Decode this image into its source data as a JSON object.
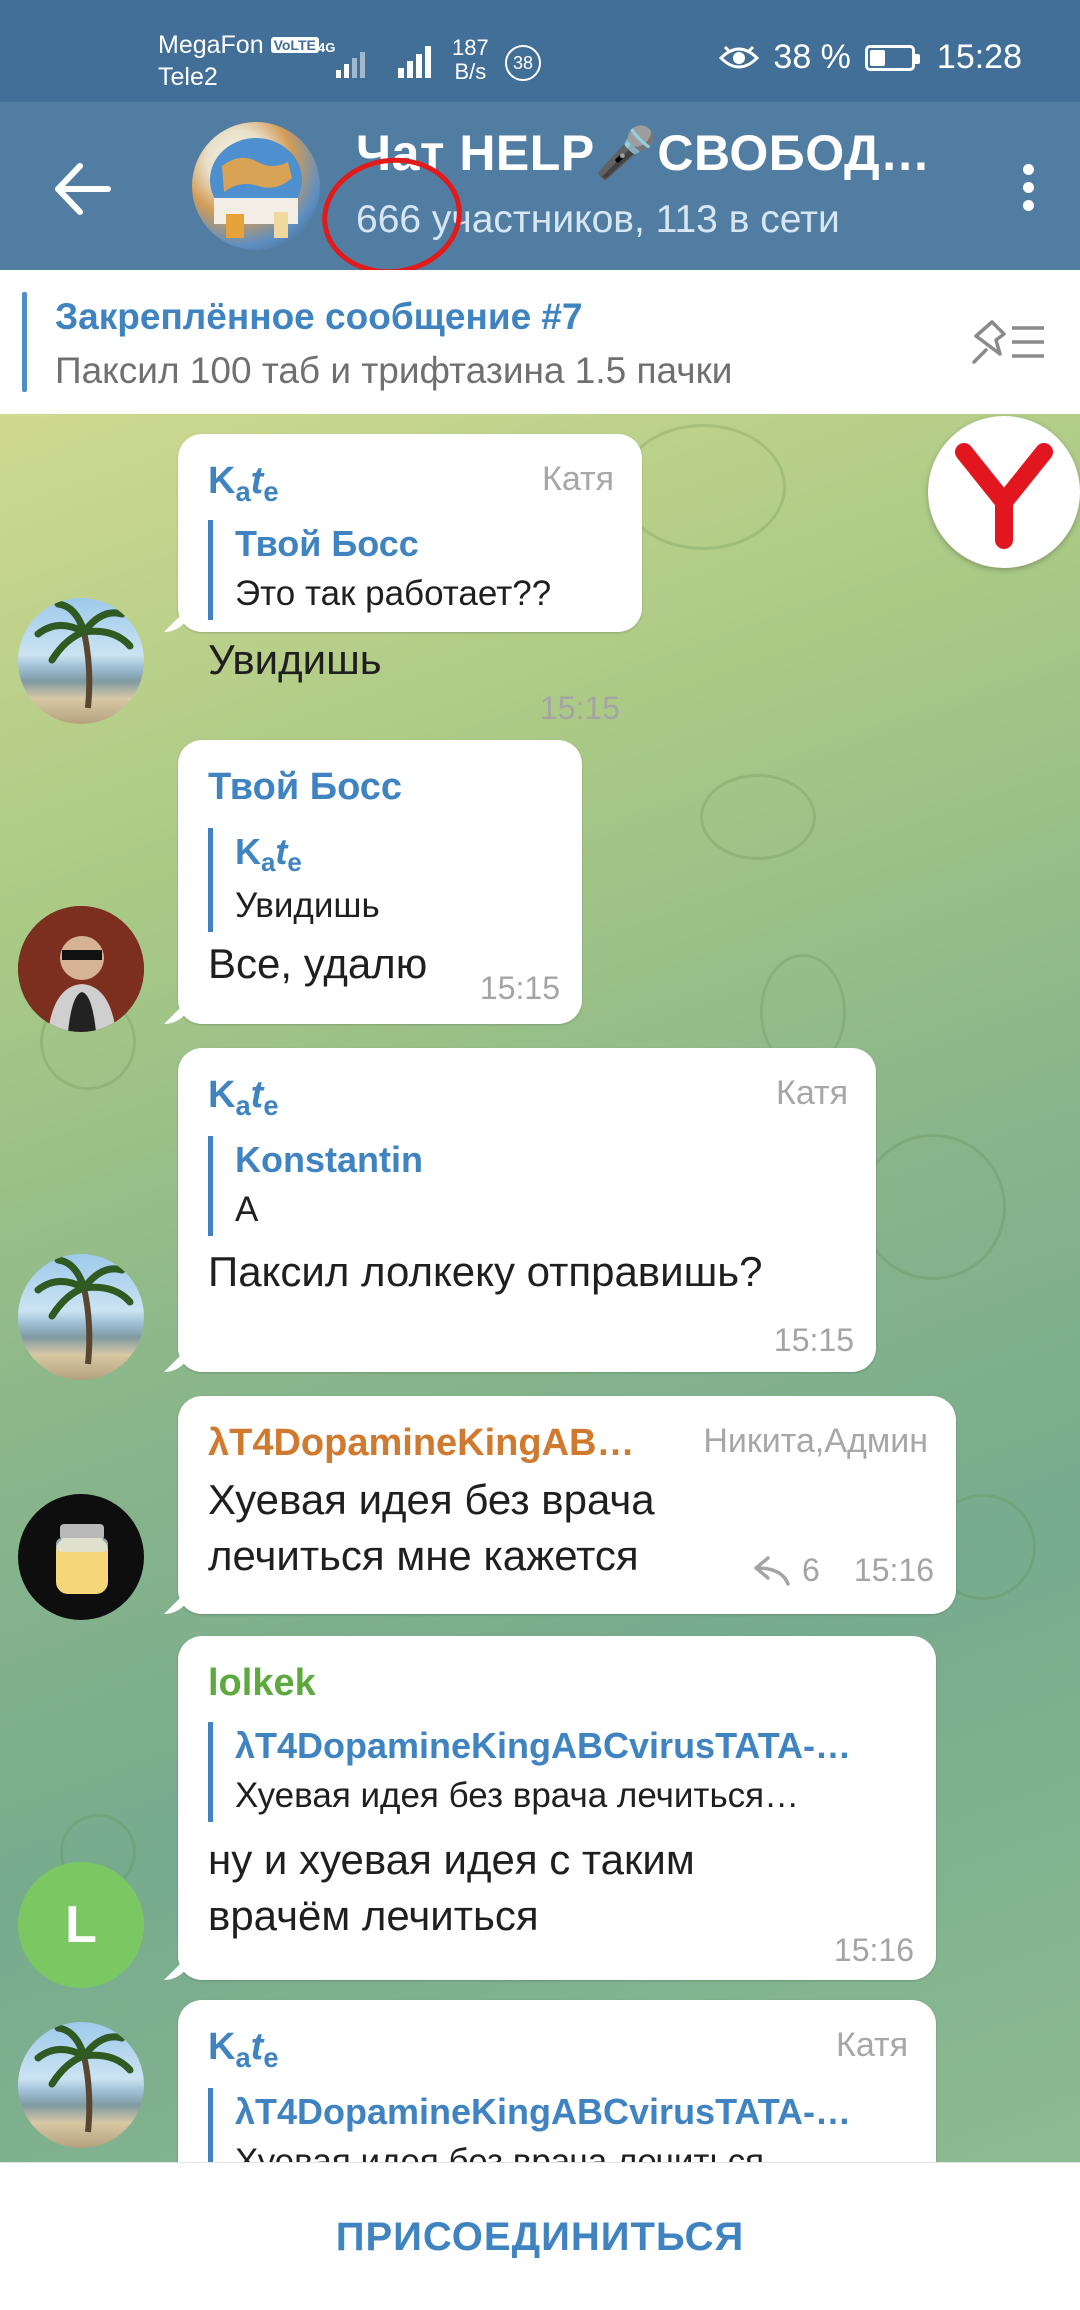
{
  "status_bar": {
    "carrier1": "MegaFon",
    "carrier1_badge": "VoLTE",
    "carrier2": "Tele2",
    "network_type": "4G",
    "speed_value": "187",
    "speed_unit": "B/s",
    "notification_count": "38",
    "battery_percent": "38 %",
    "battery_level": 0.38,
    "time": "15:28"
  },
  "header": {
    "title": "Чат HELP🎤СВОБОД…",
    "subtitle": "666 участников, 113 в сети",
    "annotation_color": "#e21a1a"
  },
  "pinned": {
    "title": "Закреплённое сообщение #7",
    "text": "Паксил 100 таб и трифтазина 1.5 пачки"
  },
  "messages": [
    {
      "sender_parts": [
        "K",
        "a",
        "t",
        "e"
      ],
      "role": "Катя",
      "reply_name": "Твой Босс",
      "reply_text": "Это так работает??",
      "text": "Увидишь",
      "time": "15:15"
    },
    {
      "sender": "Твой Босс",
      "reply_name_parts": [
        "K",
        "a",
        "t",
        "e"
      ],
      "reply_text": "Увидишь",
      "text": "Все, удалю",
      "time": "15:15"
    },
    {
      "sender_parts": [
        "K",
        "a",
        "t",
        "e"
      ],
      "role": "Катя",
      "reply_name": "Konstantin",
      "reply_text": "А",
      "text": "Паксил лолкеку отправишь?",
      "time": "15:15"
    },
    {
      "sender": "λT4DopamineKingAB…",
      "role": "Никита,Админ",
      "text_line1": "Хуевая идея без врача",
      "text_line2": "лечиться мне кажется",
      "replies_count": "6",
      "time": "15:16"
    },
    {
      "sender": "lolkek",
      "avatar_letter": "L",
      "reply_name": "λT4DopamineKingABCvirusTATA-…",
      "reply_text": "Хуевая идея без врача лечиться…",
      "text_line1": "ну и хуевая идея с таким",
      "text_line2": "врачём лечиться",
      "time": "15:16"
    },
    {
      "sender_parts": [
        "K",
        "a",
        "t",
        "e"
      ],
      "role": "Катя",
      "reply_name": "λT4DopamineKingABCvirusTATA-…",
      "reply_text": "Хуевая идея без врача лечиться…"
    }
  ],
  "join_button": "ПРИСОЕДИНИТЬСЯ",
  "colors": {
    "header_bg": "#517da2",
    "status_bg": "#426f97",
    "accent": "#3f83c0",
    "orange_name": "#d07a2f",
    "green_name": "#5ea93f"
  }
}
